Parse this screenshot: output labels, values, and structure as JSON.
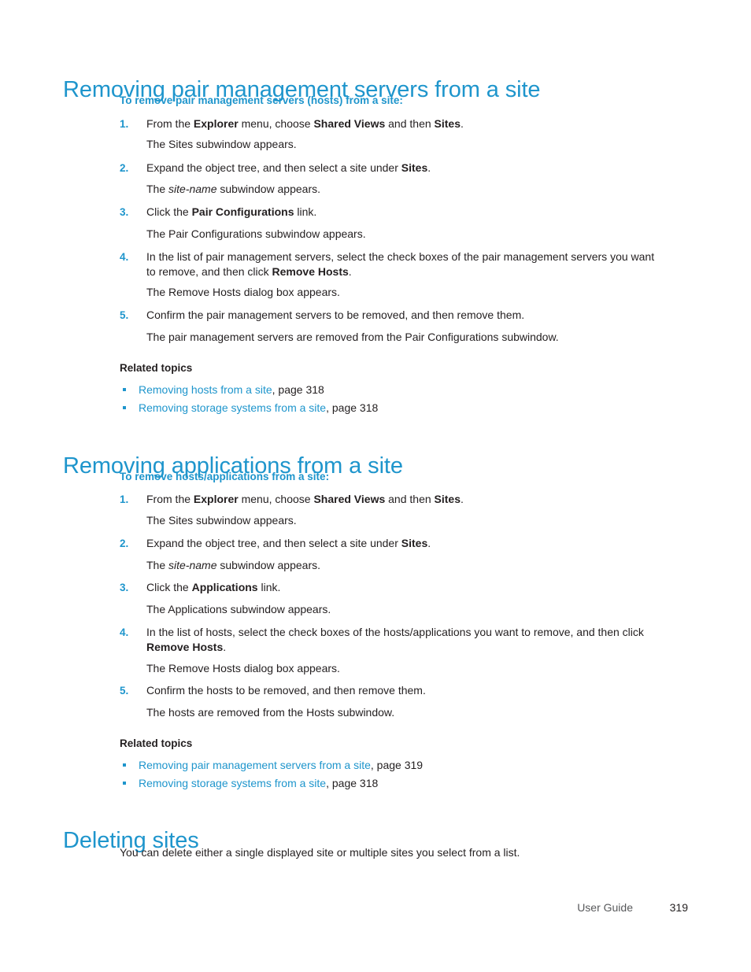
{
  "colors": {
    "heading_blue": "#1e95cc",
    "link_blue": "#1e95cc",
    "body_text": "#231f20",
    "page_background": "#ffffff"
  },
  "sections": [
    {
      "heading": "Removing pair management servers from a site",
      "subheading": "To remove pair management servers (hosts) from a site:",
      "steps": [
        {
          "number": "1.",
          "text_parts": [
            {
              "t": "From the ",
              "style": "normal"
            },
            {
              "t": "Explorer",
              "style": "bold"
            },
            {
              "t": " menu, choose ",
              "style": "normal"
            },
            {
              "t": "Shared Views",
              "style": "bold"
            },
            {
              "t": " and then ",
              "style": "normal"
            },
            {
              "t": "Sites",
              "style": "bold"
            },
            {
              "t": ".",
              "style": "normal"
            }
          ],
          "result_parts": [
            {
              "t": "The Sites subwindow appears.",
              "style": "normal"
            }
          ]
        },
        {
          "number": "2.",
          "text_parts": [
            {
              "t": "Expand the object tree, and then select a site under ",
              "style": "normal"
            },
            {
              "t": "Sites",
              "style": "bold"
            },
            {
              "t": ".",
              "style": "normal"
            }
          ],
          "result_parts": [
            {
              "t": "The ",
              "style": "normal"
            },
            {
              "t": "site-name",
              "style": "italic"
            },
            {
              "t": " subwindow appears.",
              "style": "normal"
            }
          ]
        },
        {
          "number": "3.",
          "text_parts": [
            {
              "t": "Click the ",
              "style": "normal"
            },
            {
              "t": "Pair Configurations",
              "style": "bold"
            },
            {
              "t": " link.",
              "style": "normal"
            }
          ],
          "result_parts": [
            {
              "t": "The Pair Configurations subwindow appears.",
              "style": "normal"
            }
          ]
        },
        {
          "number": "4.",
          "text_parts": [
            {
              "t": "In the list of pair management servers, select the check boxes of the pair management servers you want to remove, and then click ",
              "style": "normal"
            },
            {
              "t": "Remove Hosts",
              "style": "bold"
            },
            {
              "t": ".",
              "style": "normal"
            }
          ],
          "result_parts": [
            {
              "t": "The Remove Hosts dialog box appears.",
              "style": "normal"
            }
          ]
        },
        {
          "number": "5.",
          "text_parts": [
            {
              "t": "Confirm the pair management servers to be removed, and then remove them.",
              "style": "normal"
            }
          ],
          "result_parts": [
            {
              "t": "The pair management servers are removed from the Pair Configurations subwindow.",
              "style": "normal"
            }
          ]
        }
      ],
      "related_label": "Related topics",
      "related_links": [
        {
          "link": "Removing hosts from a site",
          "page": ", page 318"
        },
        {
          "link": "Removing storage systems from a site",
          "page": ", page 318"
        }
      ]
    },
    {
      "heading": "Removing applications from a site",
      "subheading": "To remove hosts/applications from a site:",
      "steps": [
        {
          "number": "1.",
          "text_parts": [
            {
              "t": "From the ",
              "style": "normal"
            },
            {
              "t": "Explorer",
              "style": "bold"
            },
            {
              "t": " menu, choose ",
              "style": "normal"
            },
            {
              "t": "Shared Views",
              "style": "bold"
            },
            {
              "t": " and then ",
              "style": "normal"
            },
            {
              "t": "Sites",
              "style": "bold"
            },
            {
              "t": ".",
              "style": "normal"
            }
          ],
          "result_parts": [
            {
              "t": "The Sites subwindow appears.",
              "style": "normal"
            }
          ]
        },
        {
          "number": "2.",
          "text_parts": [
            {
              "t": "Expand the object tree, and then select a site under ",
              "style": "normal"
            },
            {
              "t": "Sites",
              "style": "bold"
            },
            {
              "t": ".",
              "style": "normal"
            }
          ],
          "result_parts": [
            {
              "t": "The ",
              "style": "normal"
            },
            {
              "t": "site-name",
              "style": "italic"
            },
            {
              "t": " subwindow appears.",
              "style": "normal"
            }
          ]
        },
        {
          "number": "3.",
          "text_parts": [
            {
              "t": "Click the ",
              "style": "normal"
            },
            {
              "t": "Applications",
              "style": "bold"
            },
            {
              "t": " link.",
              "style": "normal"
            }
          ],
          "result_parts": [
            {
              "t": "The Applications subwindow appears.",
              "style": "normal"
            }
          ]
        },
        {
          "number": "4.",
          "text_parts": [
            {
              "t": "In the list of hosts, select the check boxes of the hosts/applications you want to remove, and then click ",
              "style": "normal"
            },
            {
              "t": "Remove Hosts",
              "style": "bold"
            },
            {
              "t": ".",
              "style": "normal"
            }
          ],
          "result_parts": [
            {
              "t": "The Remove Hosts dialog box appears.",
              "style": "normal"
            }
          ]
        },
        {
          "number": "5.",
          "text_parts": [
            {
              "t": "Confirm the hosts to be removed, and then remove them.",
              "style": "normal"
            }
          ],
          "result_parts": [
            {
              "t": "The hosts are removed from the Hosts subwindow.",
              "style": "normal"
            }
          ]
        }
      ],
      "related_label": "Related topics",
      "related_links": [
        {
          "link": "Removing pair management servers from a site",
          "page": ", page 319"
        },
        {
          "link": "Removing storage systems from a site",
          "page": ", page 318"
        }
      ]
    },
    {
      "heading": "Deleting sites",
      "body": "You can delete either a single displayed site or multiple sites you select from a list."
    }
  ],
  "footer": {
    "label": "User Guide",
    "page_number": "319"
  }
}
